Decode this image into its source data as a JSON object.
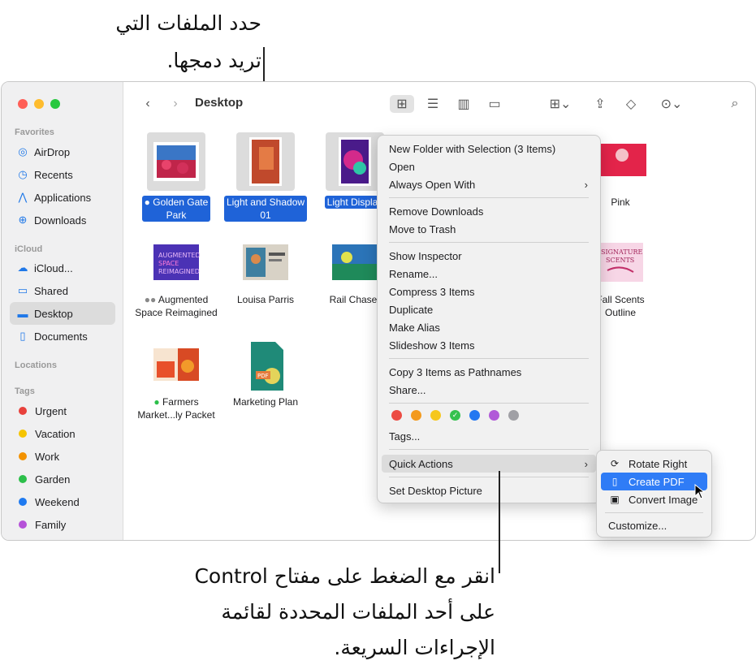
{
  "callouts": {
    "top": [
      "حدد الملفات التي",
      "تريد دمجها."
    ],
    "bottom": [
      "انقر مع الضغط على مفتاح Control",
      "على أحد الملفات المحددة لقائمة",
      "الإجراءات السريعة."
    ]
  },
  "window": {
    "title": "Desktop"
  },
  "sidebar": {
    "favorites_label": "Favorites",
    "favorites": [
      {
        "label": "AirDrop",
        "icon": "airdrop-icon"
      },
      {
        "label": "Recents",
        "icon": "clock-icon"
      },
      {
        "label": "Applications",
        "icon": "applications-icon"
      },
      {
        "label": "Downloads",
        "icon": "download-icon"
      }
    ],
    "icloud_label": "iCloud",
    "icloud": [
      {
        "label": "iCloud...",
        "icon": "cloud-icon"
      },
      {
        "label": "Shared",
        "icon": "shared-folder-icon"
      },
      {
        "label": "Desktop",
        "icon": "desktop-icon",
        "active": true
      },
      {
        "label": "Documents",
        "icon": "document-icon"
      }
    ],
    "locations_label": "Locations",
    "tags_label": "Tags",
    "tags": [
      {
        "label": "Urgent",
        "color": "#e8413c"
      },
      {
        "label": "Vacation",
        "color": "#f5c400"
      },
      {
        "label": "Work",
        "color": "#f39200"
      },
      {
        "label": "Garden",
        "color": "#2cbf4a"
      },
      {
        "label": "Weekend",
        "color": "#1f7af0"
      },
      {
        "label": "Family",
        "color": "#b551d8"
      }
    ]
  },
  "files": [
    {
      "name": "Golden Gate Park",
      "line1": "Golden Gate",
      "line2": "Park",
      "selected": true
    },
    {
      "name": "Light and Shadow 01",
      "line1": "Light and Shadow",
      "line2": "01",
      "selected": true
    },
    {
      "name": "Light Display",
      "line1": "Light Display",
      "selected": true
    },
    {
      "name": "Pink",
      "line1": "Pink"
    },
    {
      "name": "Augmented Space Reimagined",
      "line1": "Augmented",
      "line2": "Space Reimagined"
    },
    {
      "name": "Louisa Parris",
      "line1": "Louisa Parris"
    },
    {
      "name": "Rail Chaser",
      "line1": "Rail Chaser"
    },
    {
      "name": "Fall Scents Outline",
      "line1": "Fall Scents",
      "line2": "Outline"
    },
    {
      "name": "Farmers Market...ly Packet",
      "line1": "Farmers",
      "line2": "Market...ly Packet"
    },
    {
      "name": "Marketing Plan",
      "line1": "Marketing Plan"
    }
  ],
  "context_menu": {
    "items": [
      "New Folder with Selection (3 Items)",
      "Open",
      "Always Open With",
      "Remove Downloads",
      "Move to Trash",
      "Show Inspector",
      "Rename...",
      "Compress 3 Items",
      "Duplicate",
      "Make Alias",
      "Slideshow 3 Items",
      "Copy 3 Items as Pathnames",
      "Share...",
      "Tags...",
      "Quick Actions",
      "Set Desktop Picture"
    ],
    "tag_colors": [
      "#ec4b43",
      "#f39a1d",
      "#f6c71c",
      "#35c14f",
      "#2478f1",
      "#b159d8",
      "#a0a0a5"
    ]
  },
  "quick_actions": {
    "items": [
      "Rotate Right",
      "Create PDF",
      "Convert Image",
      "Customize..."
    ]
  }
}
